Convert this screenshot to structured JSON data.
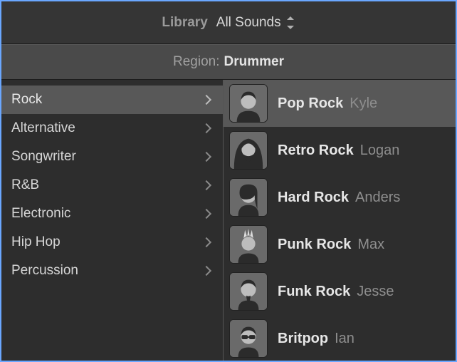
{
  "header": {
    "library_label": "Library",
    "filter_label": "All Sounds"
  },
  "region": {
    "label": "Region:",
    "value": "Drummer"
  },
  "categories": {
    "items": [
      {
        "label": "Rock",
        "selected": true
      },
      {
        "label": "Alternative",
        "selected": false
      },
      {
        "label": "Songwriter",
        "selected": false
      },
      {
        "label": "R&B",
        "selected": false
      },
      {
        "label": "Electronic",
        "selected": false
      },
      {
        "label": "Hip Hop",
        "selected": false
      },
      {
        "label": "Percussion",
        "selected": false
      }
    ]
  },
  "drummers": {
    "items": [
      {
        "style": "Pop Rock",
        "name": "Kyle",
        "selected": true,
        "avatar": "short-hair"
      },
      {
        "style": "Retro Rock",
        "name": "Logan",
        "selected": false,
        "avatar": "long-hair"
      },
      {
        "style": "Hard Rock",
        "name": "Anders",
        "selected": false,
        "avatar": "side-swept"
      },
      {
        "style": "Punk Rock",
        "name": "Max",
        "selected": false,
        "avatar": "mohawk"
      },
      {
        "style": "Funk Rock",
        "name": "Jesse",
        "selected": false,
        "avatar": "goatee"
      },
      {
        "style": "Britpop",
        "name": "Ian",
        "selected": false,
        "avatar": "sunglasses"
      }
    ]
  }
}
